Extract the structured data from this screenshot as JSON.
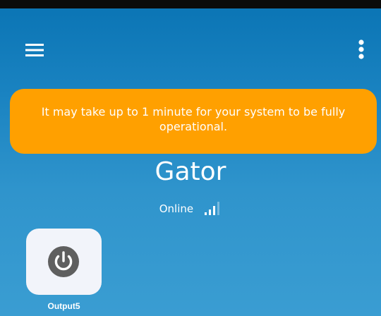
{
  "header": {
    "menu_icon": "hamburger-menu-icon",
    "more_icon": "more-vertical-icon"
  },
  "banner": {
    "message": "It may take up to 1 minute for your system to be fully operational.",
    "color": "#ffa000"
  },
  "device": {
    "name": "Gator",
    "status": "Online",
    "signal_icon": "signal-strength-icon",
    "signal_level": 0.6
  },
  "outputs": [
    {
      "label": "Output5",
      "icon": "power-icon"
    }
  ],
  "colors": {
    "background_top": "#0a74b4",
    "background_bottom": "#3a9dd2",
    "tile_background": "#f2f4fa",
    "power_icon": "#5f5f5f"
  }
}
